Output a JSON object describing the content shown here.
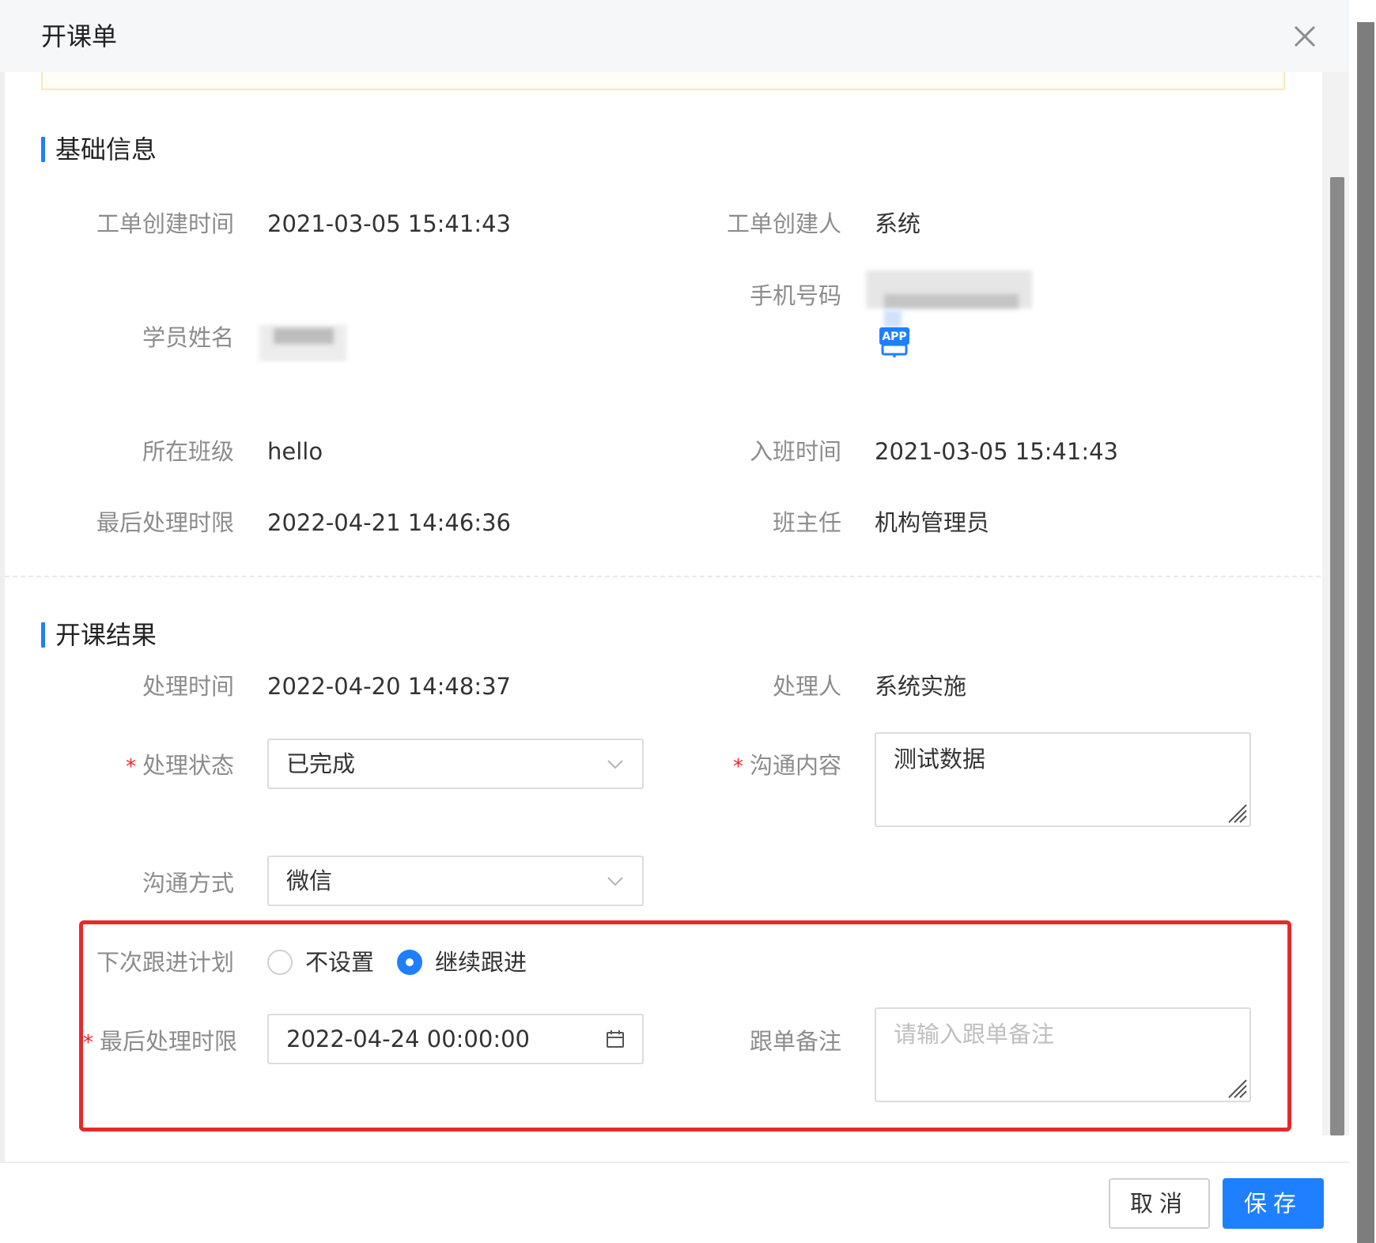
{
  "dialog": {
    "title": "开课单"
  },
  "basic": {
    "section_title": "基础信息",
    "create_time_label": "工单创建时间",
    "create_time_value": "2021-03-05 15:41:43",
    "creator_label": "工单创建人",
    "creator_value": "系统",
    "phone_label": "手机号码",
    "student_label": "学员姓名",
    "app_badge": "APP",
    "class_label": "所在班级",
    "class_value": "hello",
    "join_time_label": "入班时间",
    "join_time_value": "2021-03-05 15:41:43",
    "deadline_label": "最后处理时限",
    "deadline_value": "2022-04-21 14:46:36",
    "teacher_label": "班主任",
    "teacher_value": "机构管理员"
  },
  "result": {
    "section_title": "开课结果",
    "handle_time_label": "处理时间",
    "handle_time_value": "2022-04-20 14:48:37",
    "handler_label": "处理人",
    "handler_value": "系统实施",
    "required_mark": "*",
    "status_label": "处理状态",
    "status_value": "已完成",
    "content_label": "沟通内容",
    "content_value": "测试数据",
    "method_label": "沟通方式",
    "method_value": "微信",
    "plan_label": "下次跟进计划",
    "plan_options": [
      "不设置",
      "继续跟进"
    ],
    "plan_selected": "继续跟进",
    "next_deadline_label": "最后处理时限",
    "next_deadline_value": "2022-04-24 00:00:00",
    "remark_label": "跟单备注",
    "remark_placeholder": "请输入跟单备注"
  },
  "footer": {
    "cancel_label": "取消",
    "save_label": "保存"
  },
  "colors": {
    "primary": "#1e80ff",
    "highlight": "#e52a2a",
    "required": "#f5222d"
  }
}
